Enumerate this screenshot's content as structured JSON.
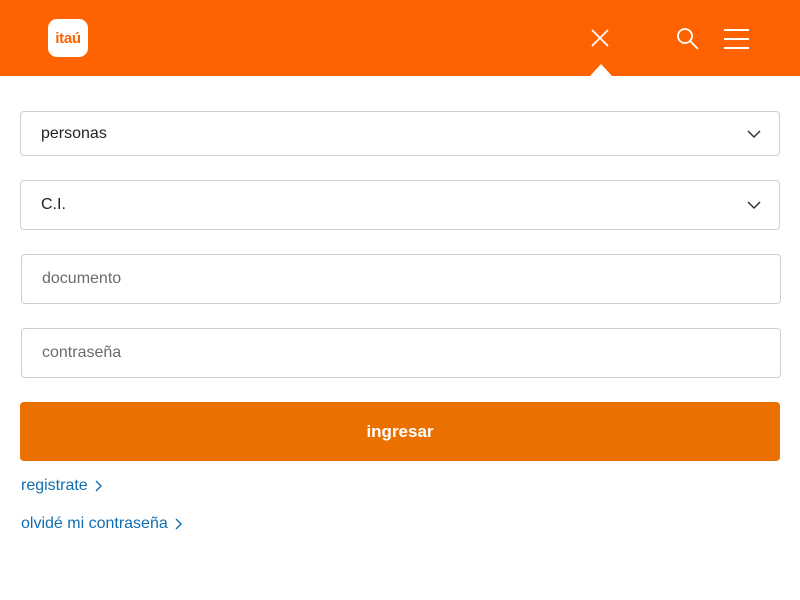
{
  "header": {
    "logo_text": "itaú",
    "background": "#ff6200",
    "icons": [
      "close-icon",
      "search-icon",
      "menu-icon"
    ]
  },
  "form": {
    "segment_select": {
      "value": "personas"
    },
    "doc_type_select": {
      "value": "C.I."
    },
    "document_input": {
      "placeholder": "documento",
      "value": ""
    },
    "password_input": {
      "placeholder": "contraseña",
      "value": ""
    },
    "submit_label": "ingresar",
    "submit_color": "#ec7000"
  },
  "links": {
    "register": "registrate",
    "forgot_password": "olvidé mi contraseña",
    "link_color": "#106eb0"
  }
}
